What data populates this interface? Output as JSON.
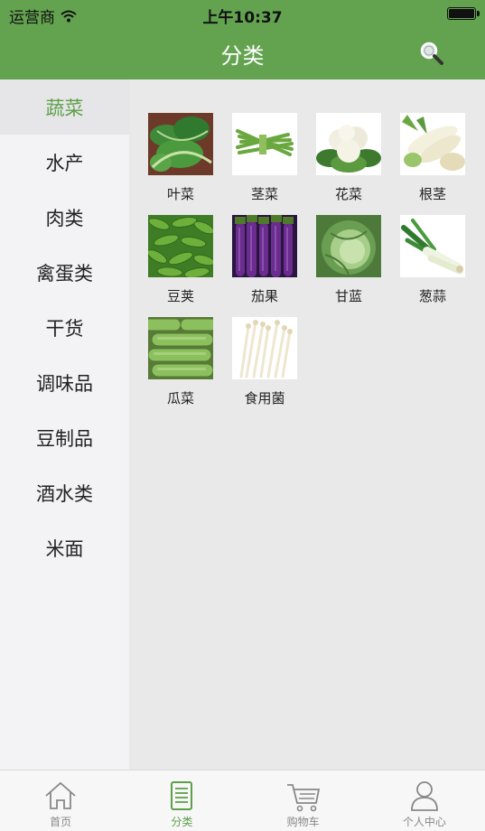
{
  "status_bar": {
    "carrier": "运营商",
    "time": "上午10:37"
  },
  "header": {
    "title": "分类",
    "search_icon": "search-icon"
  },
  "colors": {
    "brand_green": "#63a350",
    "active_text": "#5ea04a"
  },
  "sidebar": {
    "items": [
      {
        "label": "蔬菜",
        "active": true
      },
      {
        "label": "水产"
      },
      {
        "label": "肉类"
      },
      {
        "label": "禽蛋类"
      },
      {
        "label": "干货"
      },
      {
        "label": "调味品"
      },
      {
        "label": "豆制品"
      },
      {
        "label": "酒水类"
      },
      {
        "label": "米面"
      }
    ]
  },
  "grid": {
    "items": [
      {
        "label": "叶菜",
        "image": "leafy-greens"
      },
      {
        "label": "茎菜",
        "image": "asparagus"
      },
      {
        "label": "花菜",
        "image": "cauliflower"
      },
      {
        "label": "根茎",
        "image": "radish"
      },
      {
        "label": "豆荚",
        "image": "snap-peas"
      },
      {
        "label": "茄果",
        "image": "eggplant"
      },
      {
        "label": "甘蓝",
        "image": "cabbage"
      },
      {
        "label": "葱蒜",
        "image": "leek"
      },
      {
        "label": "瓜菜",
        "image": "zucchini"
      },
      {
        "label": "食用菌",
        "image": "enoki-mushroom"
      }
    ]
  },
  "tab_bar": {
    "tabs": [
      {
        "label": "首页",
        "icon": "home-icon"
      },
      {
        "label": "分类",
        "icon": "category-icon",
        "active": true
      },
      {
        "label": "购物车",
        "icon": "cart-icon"
      },
      {
        "label": "个人中心",
        "icon": "user-icon"
      }
    ]
  }
}
